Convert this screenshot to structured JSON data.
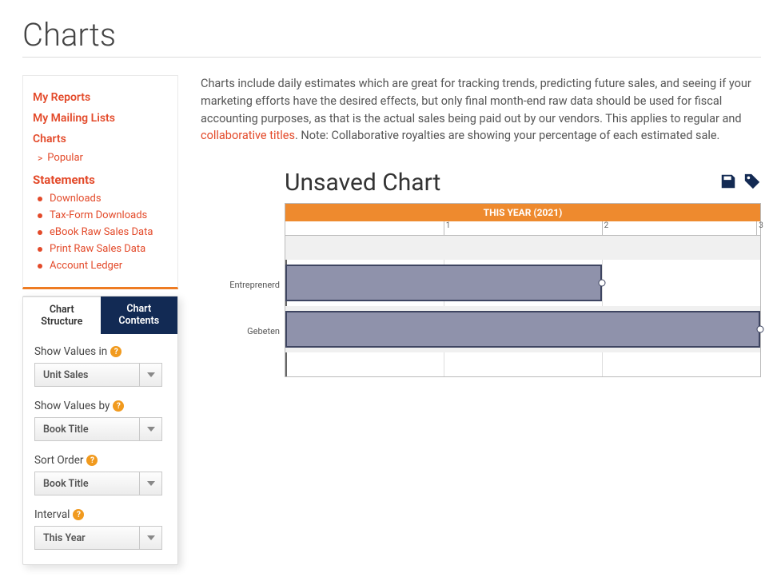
{
  "page": {
    "title": "Charts"
  },
  "nav": {
    "my_reports": "My Reports",
    "my_mailing": "My Mailing Lists",
    "charts": "Charts",
    "charts_popular": "Popular",
    "statements": "Statements",
    "st_downloads": "Downloads",
    "st_tax": "Tax-Form Downloads",
    "st_ebook": "eBook Raw Sales Data",
    "st_print": "Print Raw Sales Data",
    "st_ledger": "Account Ledger"
  },
  "intro": {
    "text_a": "Charts include daily estimates which are great for tracking trends, predicting future sales, and seeing if your marketing efforts have the desired effects, but only final month-end raw data should be used for fiscal accounting purposes, as that is the actual sales being paid out by our vendors. This applies to regular and ",
    "link": "collaborative titles",
    "text_b": ". Note: Collaborative royalties are showing your percentage of each estimated sale."
  },
  "panel": {
    "tab_structure": "Chart Structure",
    "tab_contents": "Chart Contents",
    "show_values_in_label": "Show Values in",
    "show_values_in_value": "Unit Sales",
    "show_values_by_label": "Show Values by",
    "show_values_by_value": "Book Title",
    "sort_order_label": "Sort Order",
    "sort_order_value": "Book Title",
    "interval_label": "Interval",
    "interval_value": "This Year"
  },
  "chart": {
    "title": "Unsaved Chart",
    "period_label": "THIS YEAR (2021)"
  },
  "chart_data": {
    "type": "bar",
    "orientation": "horizontal",
    "title": "Unsaved Chart",
    "period": "THIS YEAR (2021)",
    "xlabel": "",
    "ylabel": "",
    "xlim": [
      0,
      3
    ],
    "x_ticks": [
      1,
      2,
      3
    ],
    "categories": [
      "Entreprenerd",
      "Gebeten"
    ],
    "values": [
      2,
      3
    ]
  }
}
